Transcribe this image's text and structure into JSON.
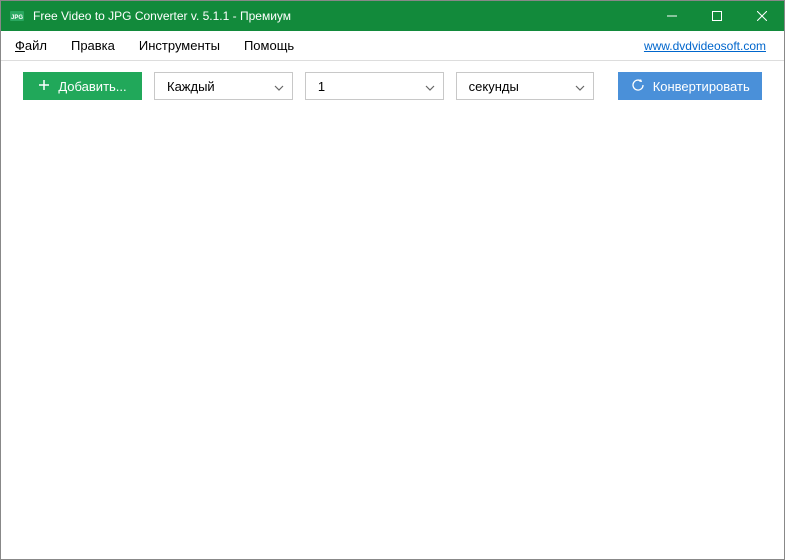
{
  "window": {
    "title": "Free Video to JPG Converter v. 5.1.1 - Премиум"
  },
  "menubar": {
    "items": [
      {
        "label": "Файл",
        "underline_first": true
      },
      {
        "label": "Правка",
        "underline_first": false
      },
      {
        "label": "Инструменты",
        "underline_first": false
      },
      {
        "label": "Помощь",
        "underline_first": false
      }
    ],
    "link": "www.dvdvideosoft.com"
  },
  "toolbar": {
    "add_label": "Добавить...",
    "combo_every": "Каждый",
    "combo_number": "1",
    "combo_unit": "секунды",
    "convert_label": "Конвертировать"
  }
}
